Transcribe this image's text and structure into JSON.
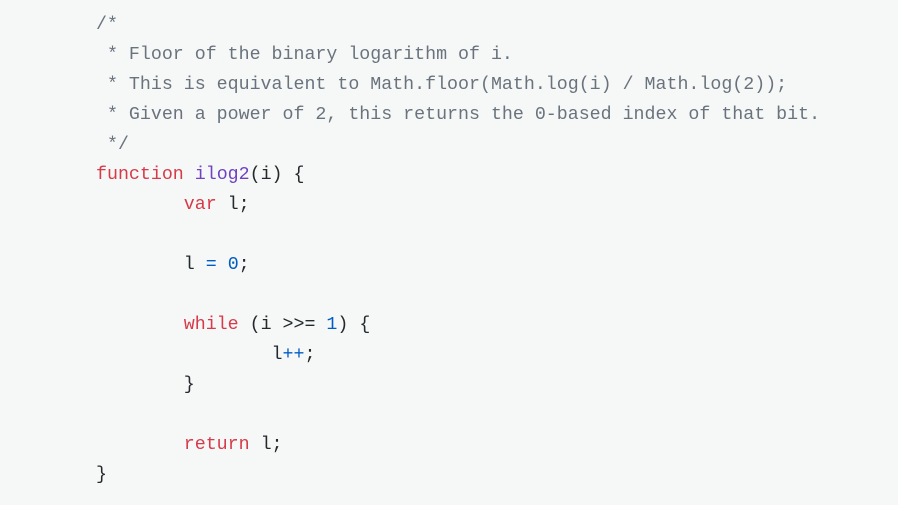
{
  "code": {
    "line1": {
      "comment": "/*"
    },
    "line2": {
      "comment": " * Floor of the binary logarithm of i."
    },
    "line3": {
      "comment": " * This is equivalent to Math.floor(Math.log(i) / Math.log(2));"
    },
    "line4": {
      "comment": " * Given a power of 2, this returns the 0-based index of that bit."
    },
    "line5": {
      "comment": " */"
    },
    "line6": {
      "keyword": "function",
      "space": " ",
      "fn_name": "ilog2",
      "rest": "(i) {"
    },
    "line7": {
      "indent": "        ",
      "keyword": "var",
      "rest": " l;"
    },
    "line8": {
      "text": ""
    },
    "line9": {
      "indent": "        ",
      "ident": "l ",
      "operator": "=",
      "space": " ",
      "number": "0",
      "rest": ";"
    },
    "line10": {
      "text": ""
    },
    "line11": {
      "indent": "        ",
      "keyword": "while",
      "pre": " (i >>= ",
      "number": "1",
      "rest": ") {"
    },
    "line12": {
      "indent": "                ",
      "ident": "l",
      "operator": "++",
      "rest": ";"
    },
    "line13": {
      "indent": "        ",
      "rest": "}"
    },
    "line14": {
      "text": ""
    },
    "line15": {
      "indent": "        ",
      "keyword": "return",
      "rest": " l;"
    },
    "line16": {
      "rest": "}"
    }
  }
}
